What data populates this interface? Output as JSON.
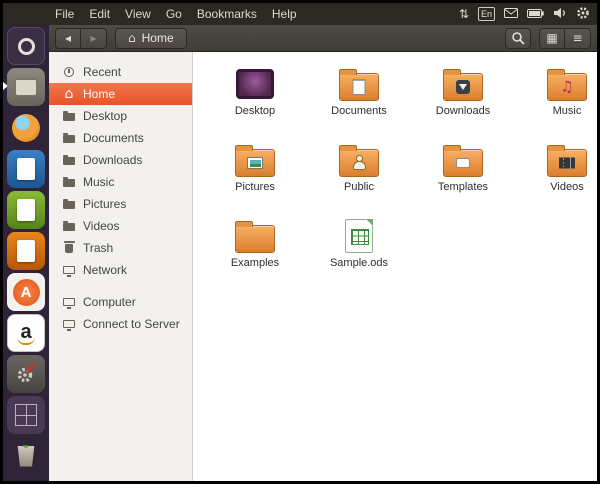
{
  "colors": {
    "accent_orange": "#E95420",
    "selection_orange": "#F2774B",
    "menubar_bg": "#2C2824",
    "toolbar_bg": "#45413C",
    "launcher_bg": "#2F2437",
    "sidebar_bg": "#F3F1ED",
    "content_bg": "#FFFFFF"
  },
  "menubar": {
    "menus": [
      "File",
      "Edit",
      "View",
      "Go",
      "Bookmarks",
      "Help"
    ],
    "indicators": {
      "keyboard_layout": "En"
    }
  },
  "icons": {
    "home_glyph": "⌂",
    "back_glyph": "◂",
    "forward_glyph": "▸",
    "grid_glyph": "▦",
    "list_glyph": "≡",
    "arrows_glyph": "⇅",
    "music_note_glyph": "♫"
  },
  "window": {
    "toolbar": {
      "breadcrumb": "Home"
    }
  },
  "sidebar": {
    "places": [
      {
        "label": "Recent",
        "icon": "clock",
        "selected": false
      },
      {
        "label": "Home",
        "icon": "home",
        "selected": true
      },
      {
        "label": "Desktop",
        "icon": "folder",
        "selected": false
      },
      {
        "label": "Documents",
        "icon": "folder",
        "selected": false
      },
      {
        "label": "Downloads",
        "icon": "folder",
        "selected": false
      },
      {
        "label": "Music",
        "icon": "folder",
        "selected": false
      },
      {
        "label": "Pictures",
        "icon": "folder",
        "selected": false
      },
      {
        "label": "Videos",
        "icon": "folder",
        "selected": false
      },
      {
        "label": "Trash",
        "icon": "trash",
        "selected": false
      },
      {
        "label": "Network",
        "icon": "network",
        "selected": false
      }
    ],
    "devices": [
      {
        "label": "Computer",
        "icon": "computer"
      },
      {
        "label": "Connect to Server",
        "icon": "server"
      }
    ]
  },
  "files": [
    {
      "name": "Desktop",
      "icon": "desktop-monitor"
    },
    {
      "name": "Documents",
      "icon": "folder-documents"
    },
    {
      "name": "Downloads",
      "icon": "folder-downloads"
    },
    {
      "name": "Music",
      "icon": "folder-music"
    },
    {
      "name": "Pictures",
      "icon": "folder-pictures"
    },
    {
      "name": "Public",
      "icon": "folder-public"
    },
    {
      "name": "Templates",
      "icon": "folder-templates"
    },
    {
      "name": "Videos",
      "icon": "folder-videos"
    },
    {
      "name": "Examples",
      "icon": "folder-plain"
    },
    {
      "name": "Sample.ods",
      "icon": "spreadsheet-document"
    }
  ],
  "launcher": {
    "items": [
      {
        "name": "dash-home"
      },
      {
        "name": "files",
        "running": true
      },
      {
        "name": "firefox"
      },
      {
        "name": "libreoffice-writer"
      },
      {
        "name": "libreoffice-calc"
      },
      {
        "name": "libreoffice-impress"
      },
      {
        "name": "ubuntu-software-center",
        "glyph": "A"
      },
      {
        "name": "amazon",
        "glyph": "a"
      },
      {
        "name": "system-settings"
      },
      {
        "name": "workspace-switcher"
      },
      {
        "name": "trash"
      }
    ]
  }
}
